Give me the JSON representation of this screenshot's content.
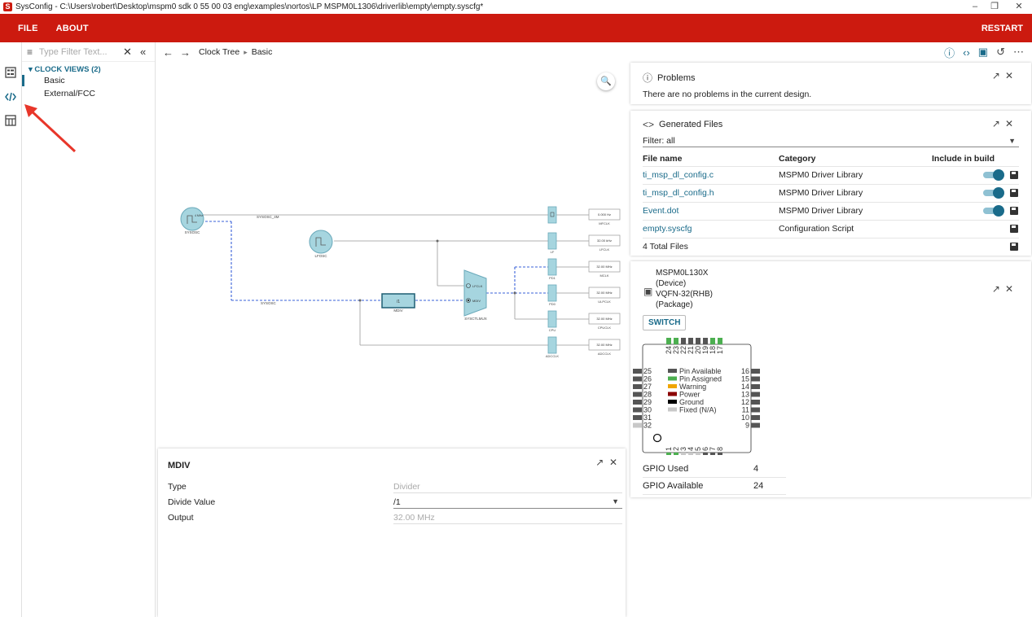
{
  "window": {
    "title": "SysConfig - C:\\Users\\robert\\Desktop\\mspm0 sdk 0 55 00 03 eng\\examples\\nortos\\LP MSPM0L1306\\driverlib\\empty\\empty.syscfg*",
    "app_icon_letter": "S",
    "minimize": "–",
    "restore": "❐",
    "close": "✕"
  },
  "menu": {
    "file": "FILE",
    "about": "ABOUT",
    "restart": "RESTART"
  },
  "tree": {
    "filter_placeholder": "Type Filter Text...",
    "heading": "CLOCK VIEWS (2)",
    "items": [
      "Basic",
      "External/FCC"
    ]
  },
  "breadcrumb": {
    "root": "Clock Tree",
    "current": "Basic"
  },
  "diagram": {
    "sources": {
      "sysosc": "SYSOSC",
      "lfosc": "LFOSC",
      "sysosc_4m": "SYSOSC_4M",
      "sysosc_line": "SYSOSC",
      "sysosc_mhz": "4 MHz"
    },
    "mdiv_label": "MDIV",
    "mdiv_box": "/1",
    "mux": {
      "name": "SYSCTLMUX",
      "opt1": "LFCLK",
      "opt2": "MDIV"
    },
    "dividers": [
      "",
      "LF",
      "PD1",
      "PD0",
      "CPU",
      "ADCCLK"
    ],
    "outputs": [
      {
        "value": "0.000 Hz",
        "name": "MFCLK"
      },
      {
        "value": "32.00 kHz",
        "name": "LFCLK"
      },
      {
        "value": "32.00 MHz",
        "name": "MCLK"
      },
      {
        "value": "32.00 MHz",
        "name": "ULPCLK"
      },
      {
        "value": "32.00 MHz",
        "name": "CPUCLK"
      },
      {
        "value": "32.00 MHz",
        "name": "ADCCLK"
      }
    ]
  },
  "mdiv_panel": {
    "title": "MDIV",
    "rows": [
      {
        "label": "Type",
        "value": "Divider"
      },
      {
        "label": "Divide Value",
        "value": "/1"
      },
      {
        "label": "Output",
        "value": "32.00 MHz"
      }
    ]
  },
  "problems": {
    "title": "Problems",
    "message": "There are no problems in the current design."
  },
  "generated_files": {
    "title": "Generated Files",
    "filter": "Filter:  all",
    "columns": [
      "File name",
      "Category",
      "Include in build"
    ],
    "rows": [
      {
        "name": "ti_msp_dl_config.c",
        "category": "MSPM0 Driver Library",
        "include": true
      },
      {
        "name": "ti_msp_dl_config.h",
        "category": "MSPM0 Driver Library",
        "include": true
      },
      {
        "name": "Event.dot",
        "category": "MSPM0 Driver Library",
        "include": true
      },
      {
        "name": "empty.syscfg",
        "category": "Configuration Script",
        "include": false
      }
    ],
    "total": "4 Total Files"
  },
  "device": {
    "line1": "MSPM0L130X",
    "line2": "(Device)",
    "line3": "VQFN-32(RHB)",
    "line4": "(Package)",
    "switch": "SWITCH",
    "legend": [
      "Pin Available",
      "Pin Assigned",
      "Warning",
      "Power",
      "Ground",
      "Fixed (N/A)"
    ],
    "legend_colors": [
      "#555555",
      "#4caf50",
      "#f0a500",
      "#8b0000",
      "#000000",
      "#c8c8c8"
    ],
    "pins_top": [
      "24",
      "23",
      "22",
      "21",
      "20",
      "19",
      "18",
      "17"
    ],
    "pins_left": [
      "25",
      "26",
      "27",
      "28",
      "29",
      "30",
      "31",
      "32"
    ],
    "pins_right": [
      "16",
      "15",
      "14",
      "13",
      "12",
      "11",
      "10",
      "9"
    ],
    "pins_bottom": [
      "1",
      "2",
      "3",
      "4",
      "5",
      "6",
      "7",
      "8"
    ],
    "gpio_used_label": "GPIO Used",
    "gpio_used": "4",
    "gpio_avail_label": "GPIO Available",
    "gpio_avail": "24"
  }
}
